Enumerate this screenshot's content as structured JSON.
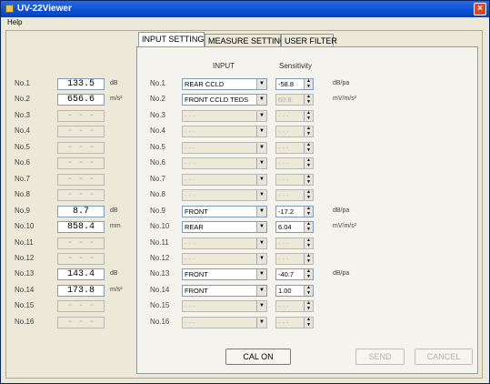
{
  "window": {
    "title": "UV-22Viewer",
    "close": "×"
  },
  "menu": {
    "help": "Help"
  },
  "tabs": [
    {
      "label": "INPUT SETTING",
      "active": true
    },
    {
      "label": "MEASURE SETTING",
      "active": false
    },
    {
      "label": "USER FILTER",
      "active": false
    }
  ],
  "headers": {
    "input": "INPUT",
    "sensitivity": "Sensitivity"
  },
  "readings": [
    {
      "label": "No.1",
      "value": "133.5",
      "unit": "dB",
      "active": true
    },
    {
      "label": "No.2",
      "value": "656.6",
      "unit": "m/s²",
      "active": true
    },
    {
      "label": "No.3",
      "value": "- - -",
      "unit": "",
      "active": false
    },
    {
      "label": "No.4",
      "value": "- - -",
      "unit": "",
      "active": false
    },
    {
      "label": "No.5",
      "value": "- - -",
      "unit": "",
      "active": false
    },
    {
      "label": "No.6",
      "value": "- - -",
      "unit": "",
      "active": false
    },
    {
      "label": "No.7",
      "value": "- - -",
      "unit": "",
      "active": false
    },
    {
      "label": "No.8",
      "value": "- - -",
      "unit": "",
      "active": false
    },
    {
      "label": "No.9",
      "value": "8.7",
      "unit": "dB",
      "active": true
    },
    {
      "label": "No.10",
      "value": "858.4",
      "unit": "mm",
      "active": true
    },
    {
      "label": "No.11",
      "value": "- - -",
      "unit": "",
      "active": false
    },
    {
      "label": "No.12",
      "value": "- - -",
      "unit": "",
      "active": false
    },
    {
      "label": "No.13",
      "value": "143.4",
      "unit": "dB",
      "active": true
    },
    {
      "label": "No.14",
      "value": "173.8",
      "unit": "m/s²",
      "active": true
    },
    {
      "label": "No.15",
      "value": "- - -",
      "unit": "",
      "active": false
    },
    {
      "label": "No.16",
      "value": "- - -",
      "unit": "",
      "active": false
    }
  ],
  "inputs": [
    {
      "label": "No.1",
      "input": "REAR CCLD",
      "sensitivity": "-58.8",
      "unit": "dB/pa",
      "enabled": true
    },
    {
      "label": "No.2",
      "input": "FRONT CCLD TEDS",
      "sensitivity": "60.8",
      "unit": "mV/m/s²",
      "enabled": true,
      "sens_disabled": true
    },
    {
      "label": "No.3",
      "input": "- - -",
      "sensitivity": "- - -",
      "unit": "",
      "enabled": false
    },
    {
      "label": "No.4",
      "input": "- - -",
      "sensitivity": "- - -",
      "unit": "",
      "enabled": false
    },
    {
      "label": "No.5",
      "input": "- - -",
      "sensitivity": "- - -",
      "unit": "",
      "enabled": false
    },
    {
      "label": "No.6",
      "input": "- - -",
      "sensitivity": "- - -",
      "unit": "",
      "enabled": false
    },
    {
      "label": "No.7",
      "input": "- - -",
      "sensitivity": "- - -",
      "unit": "",
      "enabled": false
    },
    {
      "label": "No.8",
      "input": "- - -",
      "sensitivity": "- - -",
      "unit": "",
      "enabled": false
    },
    {
      "label": "No.9",
      "input": "FRONT",
      "sensitivity": "-17.2",
      "unit": "dB/pa",
      "enabled": true
    },
    {
      "label": "No.10",
      "input": "REAR",
      "sensitivity": "6.04",
      "unit": "mV/m/s²",
      "enabled": true
    },
    {
      "label": "No.11",
      "input": "- - -",
      "sensitivity": "- - -",
      "unit": "",
      "enabled": false
    },
    {
      "label": "No.12",
      "input": "- - -",
      "sensitivity": "- - -",
      "unit": "",
      "enabled": false
    },
    {
      "label": "No.13",
      "input": "FRONT",
      "sensitivity": "-40.7",
      "unit": "dB/pa",
      "enabled": true
    },
    {
      "label": "No.14",
      "input": "FRONT",
      "sensitivity": "1.00",
      "unit": "",
      "enabled": true
    },
    {
      "label": "No.15",
      "input": "- - -",
      "sensitivity": "- - -",
      "unit": "",
      "enabled": false
    },
    {
      "label": "No.16",
      "input": "- - -",
      "sensitivity": "- - -",
      "unit": "",
      "enabled": false
    }
  ],
  "buttons": {
    "cal_on": "CAL ON",
    "send": "SEND",
    "cancel": "CANCEL"
  },
  "colors": {
    "titlebar": "#0a4fd4",
    "panel": "#ece9d8",
    "close": "#d9472b"
  }
}
